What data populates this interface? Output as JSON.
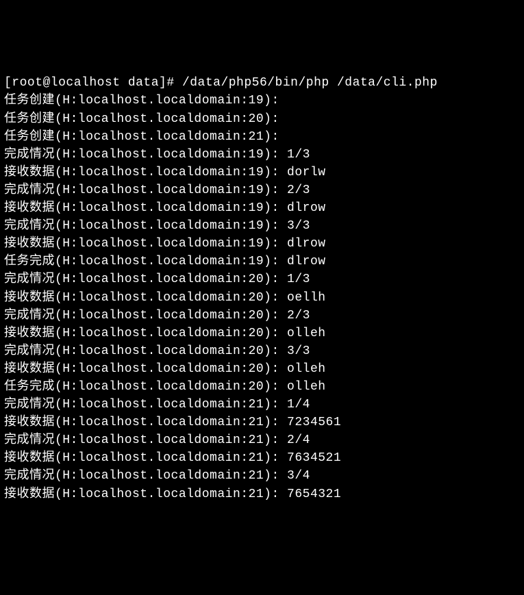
{
  "prompt": "[root@localhost data]# /data/php56/bin/php /data/cli.php",
  "lines": [
    {
      "text": "任务创建(H:localhost.localdomain:19):"
    },
    {
      "text": "任务创建(H:localhost.localdomain:20):"
    },
    {
      "text": "任务创建(H:localhost.localdomain:21):"
    },
    {
      "text": "完成情况(H:localhost.localdomain:19): 1/3"
    },
    {
      "text": "接收数据(H:localhost.localdomain:19): dorlw"
    },
    {
      "text": "完成情况(H:localhost.localdomain:19): 2/3"
    },
    {
      "text": "接收数据(H:localhost.localdomain:19): dlrow"
    },
    {
      "text": "完成情况(H:localhost.localdomain:19): 3/3"
    },
    {
      "text": "接收数据(H:localhost.localdomain:19): dlrow"
    },
    {
      "text": "任务完成(H:localhost.localdomain:19): dlrow"
    },
    {
      "text": "完成情况(H:localhost.localdomain:20): 1/3"
    },
    {
      "text": "接收数据(H:localhost.localdomain:20): oellh"
    },
    {
      "text": "完成情况(H:localhost.localdomain:20): 2/3"
    },
    {
      "text": "接收数据(H:localhost.localdomain:20): olleh"
    },
    {
      "text": "完成情况(H:localhost.localdomain:20): 3/3"
    },
    {
      "text": "接收数据(H:localhost.localdomain:20): olleh"
    },
    {
      "text": "任务完成(H:localhost.localdomain:20): olleh"
    },
    {
      "text": "完成情况(H:localhost.localdomain:21): 1/4"
    },
    {
      "text": "接收数据(H:localhost.localdomain:21): 7234561"
    },
    {
      "text": "完成情况(H:localhost.localdomain:21): 2/4"
    },
    {
      "text": "接收数据(H:localhost.localdomain:21): 7634521"
    },
    {
      "text": "完成情况(H:localhost.localdomain:21): 3/4"
    },
    {
      "text": "接收数据(H:localhost.localdomain:21): 7654321"
    }
  ]
}
